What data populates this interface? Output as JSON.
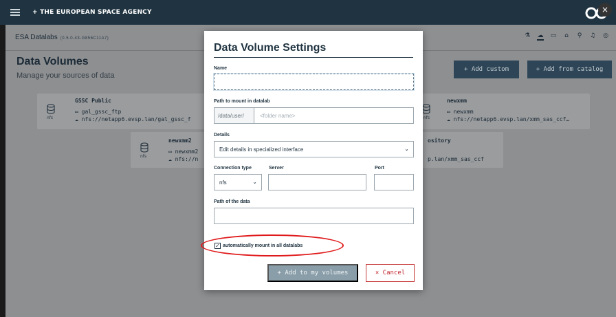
{
  "topbar": {
    "brand": "+ THE EUROPEAN SPACE AGENCY",
    "close": "×",
    "logo": "esa"
  },
  "app": {
    "title": "ESA Datalabs",
    "version": "(0.5.0-43-G856C11A7)",
    "icons": [
      "flask-icon",
      "cloud-icon",
      "folder-icon",
      "bank-icon",
      "search-icon",
      "bell-icon",
      "user-icon"
    ]
  },
  "page": {
    "title": "Data Volumes",
    "subtitle": "Manage your sources of data",
    "add_custom": "+ Add custom",
    "add_catalog": "+ Add from catalog"
  },
  "cards": [
    {
      "title": "GSSC Public",
      "folder": "gal_gssc_ftp",
      "url": "nfs://netapp6.evsp.lan/gal_gssc_f",
      "type": "nfs"
    },
    {
      "title": "newxmm",
      "folder": "newxmm",
      "url": "nfs://netapp6.evsp.lan/xmm_sas_ccf…",
      "type": "nfs"
    },
    {
      "title": "newxmm2",
      "folder": "newxmm2",
      "url": "nfs://n",
      "type": "nfs"
    },
    {
      "title": "ository",
      "url": "p.lan/xmm_sas_ccf"
    }
  ],
  "modal": {
    "title": "Data Volume Settings",
    "name_label": "Name",
    "name_value": "",
    "path_label": "Path to mount in datalab",
    "path_prefix": "/data/user/",
    "path_placeholder": "<folder name>",
    "details_label": "Details",
    "details_value": "Edit details in specialized interface",
    "conn_label": "Connection type",
    "conn_value": "nfs",
    "server_label": "Server",
    "port_label": "Port",
    "data_path_label": "Path of the data",
    "auto_mount_label": "automatically mount in all datalabs",
    "auto_mount_checked": true,
    "add_button": "+ Add to my volumes",
    "cancel_button": "× Cancel"
  },
  "colors": {
    "header": "#1f3340",
    "accent": "#2d4556",
    "highlight": "#e0191b"
  }
}
